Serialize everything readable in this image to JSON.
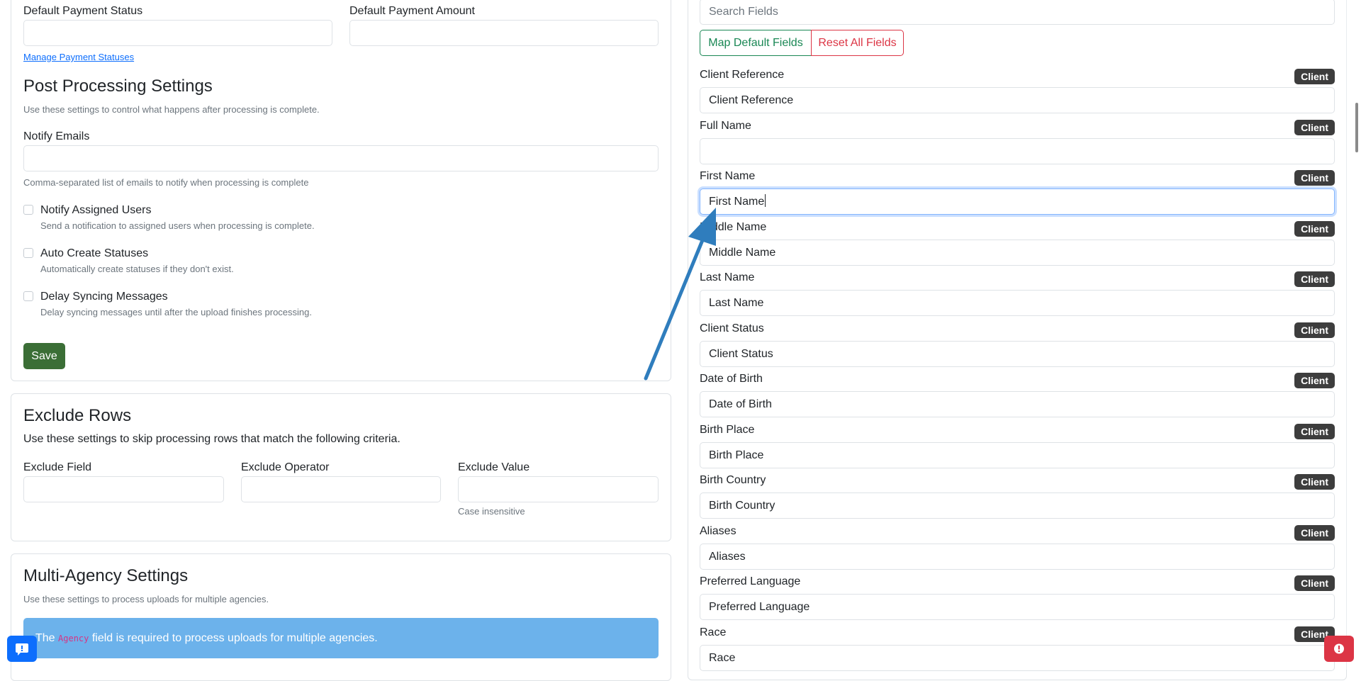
{
  "left": {
    "payment": {
      "status_label": "Default Payment Status",
      "amount_label": "Default Payment Amount",
      "manage_link": "Manage Payment Statuses"
    },
    "post_processing": {
      "title": "Post Processing Settings",
      "description": "Use these settings to control what happens after processing is complete.",
      "notify_emails_label": "Notify Emails",
      "notify_emails_help": "Comma-separated list of emails to notify when processing is complete",
      "options": [
        {
          "label": "Notify Assigned Users",
          "help": "Send a notification to assigned users when processing is complete."
        },
        {
          "label": "Auto Create Statuses",
          "help": "Automatically create statuses if they don't exist."
        },
        {
          "label": "Delay Syncing Messages",
          "help": "Delay syncing messages until after the upload finishes processing."
        }
      ],
      "save_label": "Save"
    },
    "exclude_rows": {
      "title": "Exclude Rows",
      "description": "Use these settings to skip processing rows that match the following criteria.",
      "field_label": "Exclude Field",
      "operator_label": "Exclude Operator",
      "value_label": "Exclude Value",
      "value_help": "Case insensitive"
    },
    "multi_agency": {
      "title": "Multi-Agency Settings",
      "description": "Use these settings to process uploads for multiple agencies.",
      "alert_pre": "The",
      "alert_code": "Agency",
      "alert_post": "field is required to process uploads for multiple agencies."
    }
  },
  "right": {
    "search_placeholder": "Search Fields",
    "map_default_label": "Map Default Fields",
    "reset_all_label": "Reset All Fields",
    "fields": [
      {
        "label": "Client Reference",
        "badge": "Client",
        "value": "Client Reference"
      },
      {
        "label": "Full Name",
        "badge": "Client",
        "value": ""
      },
      {
        "label": "First Name",
        "badge": "Client",
        "value": "First Name"
      },
      {
        "label": "Middle Name",
        "badge": "Client",
        "value": "Middle Name"
      },
      {
        "label": "Last Name",
        "badge": "Client",
        "value": "Last Name"
      },
      {
        "label": "Client Status",
        "badge": "Client",
        "value": "Client Status"
      },
      {
        "label": "Date of Birth",
        "badge": "Client",
        "value": "Date of Birth"
      },
      {
        "label": "Birth Place",
        "badge": "Client",
        "value": "Birth Place"
      },
      {
        "label": "Birth Country",
        "badge": "Client",
        "value": "Birth Country"
      },
      {
        "label": "Aliases",
        "badge": "Client",
        "value": "Aliases"
      },
      {
        "label": "Preferred Language",
        "badge": "Client",
        "value": "Preferred Language"
      },
      {
        "label": "Race",
        "badge": "Client",
        "value": "Race"
      }
    ]
  },
  "colors": {
    "save_button": "#3b6e36",
    "map_default": "#198754",
    "reset_all": "#dc3545",
    "badge": "#3d3d3d",
    "alert": "#6cb2eb",
    "annotation_arrow": "#2f7dbd",
    "chat_button": "#0d6efd",
    "error_button": "#dc3545"
  },
  "icons": {
    "chat": "chat-bubble-icon",
    "error": "exclamation-circle-icon",
    "annotation": "arrow-annotation"
  }
}
